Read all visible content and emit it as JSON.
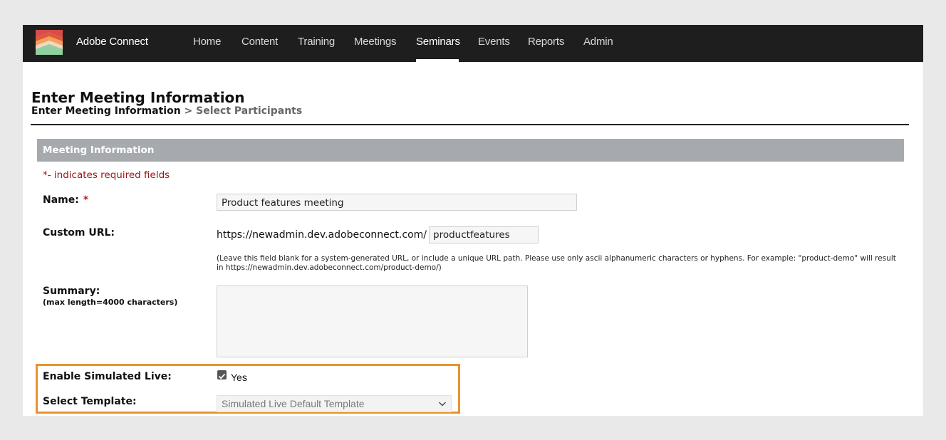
{
  "app": {
    "brand": "Adobe Connect",
    "accent_color": "#e8932f",
    "nav": [
      {
        "label": "Home",
        "active": false
      },
      {
        "label": "Content",
        "active": false
      },
      {
        "label": "Training",
        "active": false
      },
      {
        "label": "Meetings",
        "active": false
      },
      {
        "label": "Seminars",
        "active": true
      },
      {
        "label": "Events",
        "active": false
      },
      {
        "label": "Reports",
        "active": false
      },
      {
        "label": "Admin",
        "active": false
      }
    ]
  },
  "page": {
    "title": "Enter Meeting Information",
    "breadcrumb": {
      "current": "Enter Meeting Information",
      "separator": ">",
      "next": "Select Participants"
    }
  },
  "form": {
    "section_title": "Meeting Information",
    "required_note": "*- indicates required fields",
    "name": {
      "label": "Name:",
      "required_mark": "*",
      "value": "Product features meeting"
    },
    "custom_url": {
      "label": "Custom URL:",
      "prefix": "https://newadmin.dev.adobeconnect.com/",
      "value": "productfeatures",
      "help": "(Leave this field blank for a system-generated URL, or include a unique URL path. Please use only ascii alphanumeric characters or hyphens. For example: \"product-demo\" will result in https://newadmin.dev.adobeconnect.com/product-demo/)"
    },
    "summary": {
      "label": "Summary:",
      "sublabel": "(max length=4000 characters)",
      "value": ""
    },
    "simulated_live": {
      "label": "Enable Simulated Live:",
      "checked": true,
      "option_label": "Yes"
    },
    "template": {
      "label": "Select Template:",
      "selected": "Simulated Live Default Template"
    }
  }
}
